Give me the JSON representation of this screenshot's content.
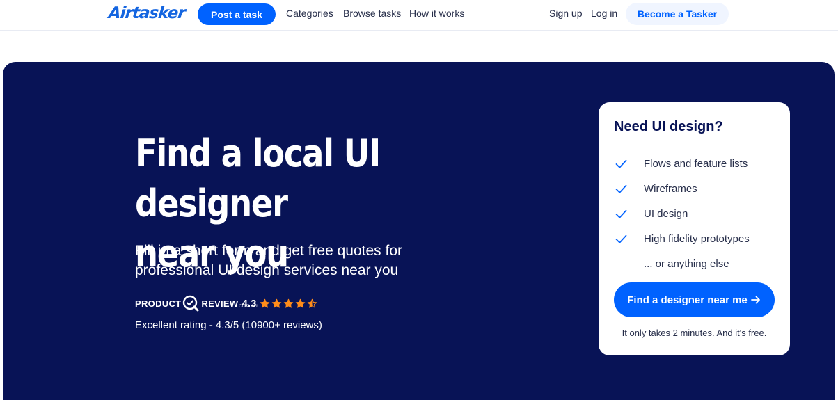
{
  "header": {
    "logo": "Airtasker",
    "post_task_label": "Post a task",
    "nav": [
      "Categories",
      "Browse tasks",
      "How it works"
    ],
    "signup_label": "Sign up",
    "login_label": "Log in",
    "become_tasker_label": "Become a Tasker"
  },
  "hero": {
    "title_line1": "Find a local UI designer",
    "title_line2": "near you",
    "subtitle": "Fill in a short form and get free quotes for professional UI design services near you",
    "product_review": {
      "word_left": "PRODUCT",
      "word_right": "REVIEW",
      "domain": ".COM.AU",
      "score": "4.3",
      "stars": 4.3,
      "rating_text": "Excellent rating - 4.3/5 (10900+ reviews)"
    }
  },
  "card": {
    "title": "Need UI design?",
    "items": [
      "Flows and feature lists",
      "Wireframes",
      "UI design",
      "High fidelity prototypes"
    ],
    "extra_item": "... or anything else",
    "cta_label": "Find a designer near me",
    "note": "It only takes 2 minutes. And it's free."
  },
  "colors": {
    "primary": "#0062ff",
    "hero_bg": "#081356",
    "star": "#ff8c1a",
    "text_dark": "#262d49"
  }
}
